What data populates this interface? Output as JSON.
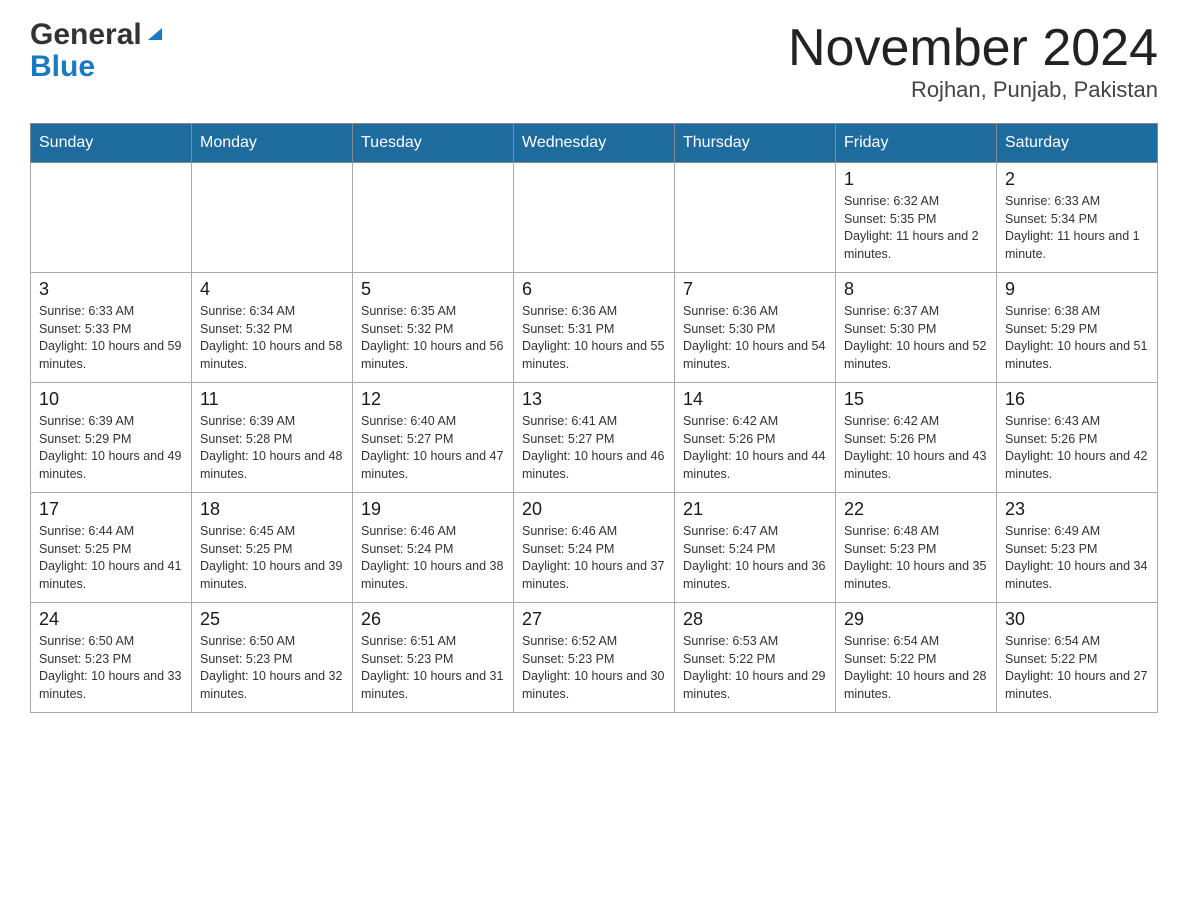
{
  "header": {
    "logo": {
      "general": "General",
      "blue": "Blue"
    },
    "month_year": "November 2024",
    "location": "Rojhan, Punjab, Pakistan"
  },
  "weekdays": [
    "Sunday",
    "Monday",
    "Tuesday",
    "Wednesday",
    "Thursday",
    "Friday",
    "Saturday"
  ],
  "weeks": [
    {
      "days": [
        {
          "number": "",
          "info": ""
        },
        {
          "number": "",
          "info": ""
        },
        {
          "number": "",
          "info": ""
        },
        {
          "number": "",
          "info": ""
        },
        {
          "number": "",
          "info": ""
        },
        {
          "number": "1",
          "info": "Sunrise: 6:32 AM\nSunset: 5:35 PM\nDaylight: 11 hours and 2 minutes."
        },
        {
          "number": "2",
          "info": "Sunrise: 6:33 AM\nSunset: 5:34 PM\nDaylight: 11 hours and 1 minute."
        }
      ]
    },
    {
      "days": [
        {
          "number": "3",
          "info": "Sunrise: 6:33 AM\nSunset: 5:33 PM\nDaylight: 10 hours and 59 minutes."
        },
        {
          "number": "4",
          "info": "Sunrise: 6:34 AM\nSunset: 5:32 PM\nDaylight: 10 hours and 58 minutes."
        },
        {
          "number": "5",
          "info": "Sunrise: 6:35 AM\nSunset: 5:32 PM\nDaylight: 10 hours and 56 minutes."
        },
        {
          "number": "6",
          "info": "Sunrise: 6:36 AM\nSunset: 5:31 PM\nDaylight: 10 hours and 55 minutes."
        },
        {
          "number": "7",
          "info": "Sunrise: 6:36 AM\nSunset: 5:30 PM\nDaylight: 10 hours and 54 minutes."
        },
        {
          "number": "8",
          "info": "Sunrise: 6:37 AM\nSunset: 5:30 PM\nDaylight: 10 hours and 52 minutes."
        },
        {
          "number": "9",
          "info": "Sunrise: 6:38 AM\nSunset: 5:29 PM\nDaylight: 10 hours and 51 minutes."
        }
      ]
    },
    {
      "days": [
        {
          "number": "10",
          "info": "Sunrise: 6:39 AM\nSunset: 5:29 PM\nDaylight: 10 hours and 49 minutes."
        },
        {
          "number": "11",
          "info": "Sunrise: 6:39 AM\nSunset: 5:28 PM\nDaylight: 10 hours and 48 minutes."
        },
        {
          "number": "12",
          "info": "Sunrise: 6:40 AM\nSunset: 5:27 PM\nDaylight: 10 hours and 47 minutes."
        },
        {
          "number": "13",
          "info": "Sunrise: 6:41 AM\nSunset: 5:27 PM\nDaylight: 10 hours and 46 minutes."
        },
        {
          "number": "14",
          "info": "Sunrise: 6:42 AM\nSunset: 5:26 PM\nDaylight: 10 hours and 44 minutes."
        },
        {
          "number": "15",
          "info": "Sunrise: 6:42 AM\nSunset: 5:26 PM\nDaylight: 10 hours and 43 minutes."
        },
        {
          "number": "16",
          "info": "Sunrise: 6:43 AM\nSunset: 5:26 PM\nDaylight: 10 hours and 42 minutes."
        }
      ]
    },
    {
      "days": [
        {
          "number": "17",
          "info": "Sunrise: 6:44 AM\nSunset: 5:25 PM\nDaylight: 10 hours and 41 minutes."
        },
        {
          "number": "18",
          "info": "Sunrise: 6:45 AM\nSunset: 5:25 PM\nDaylight: 10 hours and 39 minutes."
        },
        {
          "number": "19",
          "info": "Sunrise: 6:46 AM\nSunset: 5:24 PM\nDaylight: 10 hours and 38 minutes."
        },
        {
          "number": "20",
          "info": "Sunrise: 6:46 AM\nSunset: 5:24 PM\nDaylight: 10 hours and 37 minutes."
        },
        {
          "number": "21",
          "info": "Sunrise: 6:47 AM\nSunset: 5:24 PM\nDaylight: 10 hours and 36 minutes."
        },
        {
          "number": "22",
          "info": "Sunrise: 6:48 AM\nSunset: 5:23 PM\nDaylight: 10 hours and 35 minutes."
        },
        {
          "number": "23",
          "info": "Sunrise: 6:49 AM\nSunset: 5:23 PM\nDaylight: 10 hours and 34 minutes."
        }
      ]
    },
    {
      "days": [
        {
          "number": "24",
          "info": "Sunrise: 6:50 AM\nSunset: 5:23 PM\nDaylight: 10 hours and 33 minutes."
        },
        {
          "number": "25",
          "info": "Sunrise: 6:50 AM\nSunset: 5:23 PM\nDaylight: 10 hours and 32 minutes."
        },
        {
          "number": "26",
          "info": "Sunrise: 6:51 AM\nSunset: 5:23 PM\nDaylight: 10 hours and 31 minutes."
        },
        {
          "number": "27",
          "info": "Sunrise: 6:52 AM\nSunset: 5:23 PM\nDaylight: 10 hours and 30 minutes."
        },
        {
          "number": "28",
          "info": "Sunrise: 6:53 AM\nSunset: 5:22 PM\nDaylight: 10 hours and 29 minutes."
        },
        {
          "number": "29",
          "info": "Sunrise: 6:54 AM\nSunset: 5:22 PM\nDaylight: 10 hours and 28 minutes."
        },
        {
          "number": "30",
          "info": "Sunrise: 6:54 AM\nSunset: 5:22 PM\nDaylight: 10 hours and 27 minutes."
        }
      ]
    }
  ]
}
